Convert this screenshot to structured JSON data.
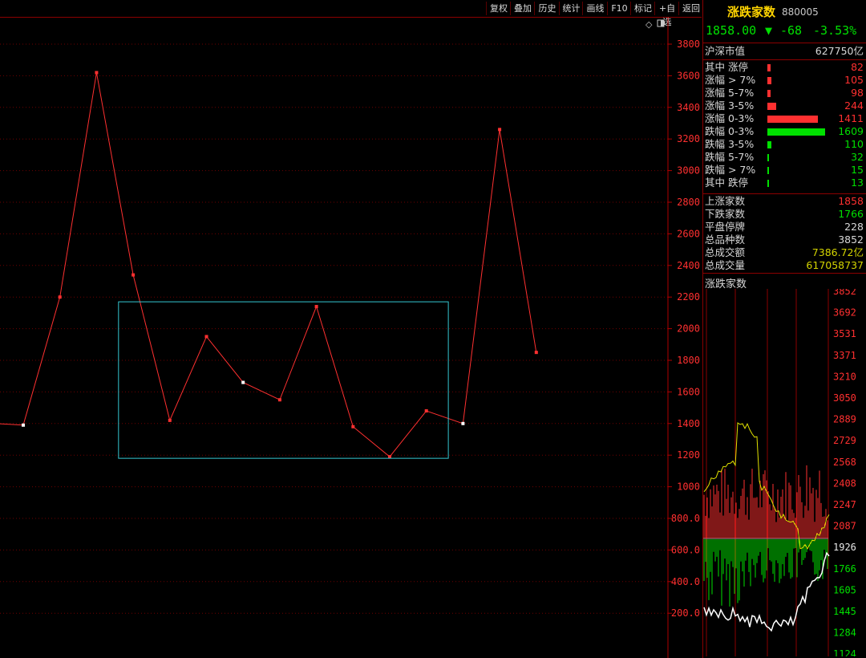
{
  "toolbar": {
    "buttons": [
      "复权",
      "叠加",
      "历史",
      "统计",
      "画线",
      "F10",
      "标记",
      "+自选",
      "返回"
    ],
    "top_icons": [
      "diamond-icon",
      "window-icon"
    ]
  },
  "colors": {
    "up": "#ff3030",
    "down": "#00e000",
    "accent": "#ffd400",
    "grid": "#8b0000",
    "box": "#35c6d0"
  },
  "main_chart": {
    "y_ticks": [
      "3800",
      "3600",
      "3400",
      "3200",
      "3000",
      "2800",
      "2600",
      "2400",
      "2200",
      "2000",
      "1800",
      "1600",
      "1400",
      "1200",
      "1000",
      "800.0",
      "600.0",
      "400.0",
      "200.0"
    ]
  },
  "chart_data": {
    "type": "line",
    "y_range": [
      100,
      3900
    ],
    "series": [
      {
        "values": [
          1400,
          1390,
          2200,
          3620,
          2340,
          1420,
          1950,
          1660,
          1550,
          2140,
          1380,
          1190,
          1480,
          1400,
          3260,
          1850
        ],
        "highlight_points": [
          1,
          7,
          13
        ]
      }
    ],
    "selection_box": {
      "x_from": 3.6,
      "x_to": 12.6,
      "y_from": 1180,
      "y_to": 2170
    },
    "grid": true
  },
  "panel": {
    "title": "涨跌家数",
    "code": "880005",
    "price": "1858.00",
    "arrow": "▼",
    "change": "-68",
    "change_pct": "-3.53%",
    "market_cap_label": "沪深市值",
    "market_cap_value": "627750亿",
    "breakdown": [
      {
        "label": "其中 涨停",
        "value": "82",
        "frac": 0.05,
        "dir": "up"
      },
      {
        "label": "涨幅 > 7%",
        "value": "105",
        "frac": 0.065,
        "dir": "up"
      },
      {
        "label": "涨幅 5-7%",
        "value": "98",
        "frac": 0.061,
        "dir": "up"
      },
      {
        "label": "涨幅 3-5%",
        "value": "244",
        "frac": 0.152,
        "dir": "up"
      },
      {
        "label": "涨幅 0-3%",
        "value": "1411",
        "frac": 0.877,
        "dir": "up"
      },
      {
        "label": "跌幅 0-3%",
        "value": "1609",
        "frac": 1.0,
        "dir": "down"
      },
      {
        "label": "跌幅 3-5%",
        "value": "110",
        "frac": 0.068,
        "dir": "down"
      },
      {
        "label": "跌幅 5-7%",
        "value": "32",
        "frac": 0.02,
        "dir": "down"
      },
      {
        "label": "跌幅 > 7%",
        "value": "15",
        "frac": 0.01,
        "dir": "down"
      },
      {
        "label": "其中 跌停",
        "value": "13",
        "frac": 0.008,
        "dir": "down"
      }
    ],
    "stats": [
      {
        "label": "上涨家数",
        "value": "1858",
        "color": "#ff3030"
      },
      {
        "label": "下跌家数",
        "value": "1766",
        "color": "#00e000"
      },
      {
        "label": "平盘停牌",
        "value": "228",
        "color": "#d8d8d8"
      },
      {
        "label": "总品种数",
        "value": "3852",
        "color": "#d8d8d8"
      },
      {
        "label": "总成交额",
        "value": "7386.72亿",
        "color": "#d4d400"
      },
      {
        "label": "总成交量",
        "value": "617058737",
        "color": "#d4d400"
      }
    ],
    "mini_chart_label": "涨跌家数",
    "mini_y_ticks": [
      {
        "v": "3852",
        "c": "#ff3030"
      },
      {
        "v": "3692",
        "c": "#ff3030"
      },
      {
        "v": "3531",
        "c": "#ff3030"
      },
      {
        "v": "3371",
        "c": "#ff3030"
      },
      {
        "v": "3210",
        "c": "#ff3030"
      },
      {
        "v": "3050",
        "c": "#ff3030"
      },
      {
        "v": "2889",
        "c": "#ff3030"
      },
      {
        "v": "2729",
        "c": "#ff3030"
      },
      {
        "v": "2568",
        "c": "#ff3030"
      },
      {
        "v": "2408",
        "c": "#ff3030"
      },
      {
        "v": "2247",
        "c": "#ff3030"
      },
      {
        "v": "2087",
        "c": "#ff3030"
      },
      {
        "v": "1926",
        "c": "#e8e8e8"
      },
      {
        "v": "1766",
        "c": "#00e000"
      },
      {
        "v": "1605",
        "c": "#00e000"
      },
      {
        "v": "1445",
        "c": "#00e000"
      },
      {
        "v": "1284",
        "c": "#00e000"
      },
      {
        "v": "1124",
        "c": "#00e000"
      }
    ]
  }
}
